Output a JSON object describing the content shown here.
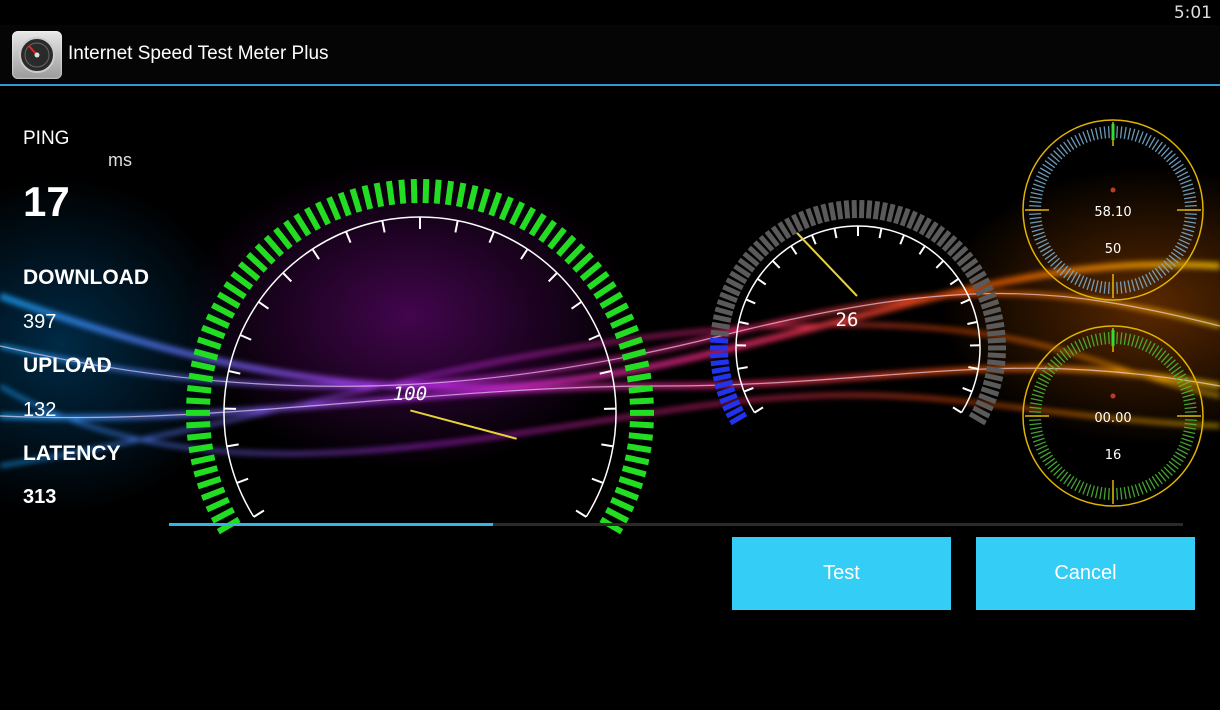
{
  "status_bar": {
    "time": "5:01"
  },
  "app": {
    "title": "Internet Speed Test Meter Plus",
    "icon": "speedometer-app-icon"
  },
  "stats": {
    "ping_label": "PING",
    "ping_unit": "ms",
    "ping_value": "17",
    "download_label": "DOWNLOAD",
    "download_value": "397",
    "upload_label": "UPLOAD",
    "upload_value": "132",
    "latency_label": "LATENCY",
    "latency_value": "313"
  },
  "gauges": {
    "main": {
      "readout": "100",
      "fill_fraction": 1.0,
      "needle_fraction": 0.93,
      "active_color": "#22dd22"
    },
    "secondary": {
      "readout": "26",
      "fill_fraction": 0.15,
      "needle_fraction": 0.26,
      "active_color": "#2233ee",
      "inactive_color": "#5a5a5a"
    },
    "small_top": {
      "line1": "58.10",
      "line2": "50",
      "ring_color": "#e0b400"
    },
    "small_bottom": {
      "line1": "00.00",
      "line2": "16",
      "ring_color": "#e0b400"
    }
  },
  "progress": {
    "fraction": 0.32
  },
  "buttons": {
    "test_label": "Test",
    "cancel_label": "Cancel"
  },
  "colors": {
    "accent": "#33b5e5",
    "button": "#33cdf5"
  }
}
